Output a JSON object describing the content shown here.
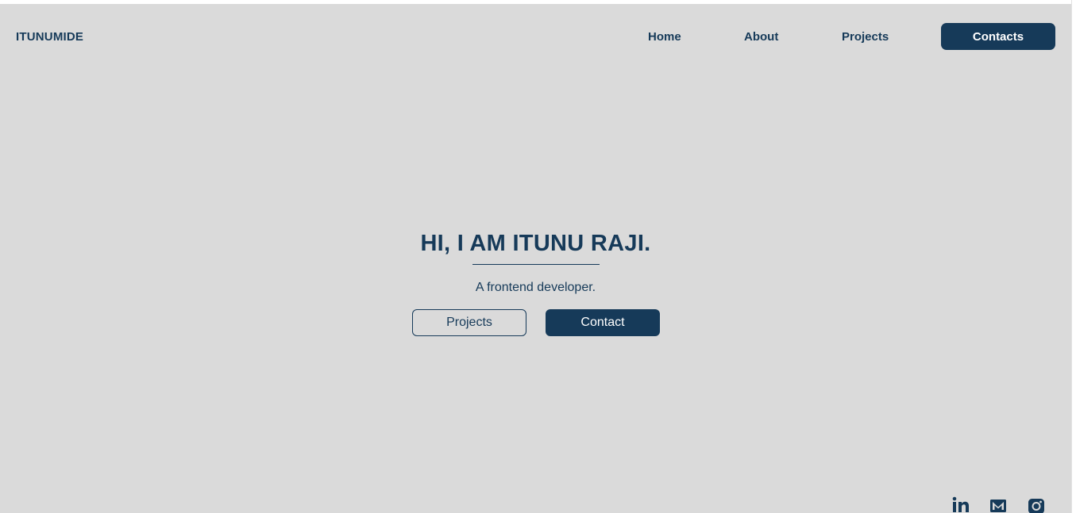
{
  "nav": {
    "brand": "ITUNUMIDE",
    "links": [
      {
        "label": "Home"
      },
      {
        "label": "About"
      },
      {
        "label": "Projects"
      }
    ],
    "cta_label": "Contacts"
  },
  "hero": {
    "title": "HI, I AM ITUNU RAJI.",
    "subtitle": "A frontend developer.",
    "projects_button": "Projects",
    "contact_button": "Contact"
  },
  "social": {
    "icons": [
      "linkedin-icon",
      "mail-icon",
      "instagram-icon"
    ]
  },
  "colors": {
    "background": "#dadada",
    "accent": "#163a59",
    "button_text": "#ffffff"
  }
}
